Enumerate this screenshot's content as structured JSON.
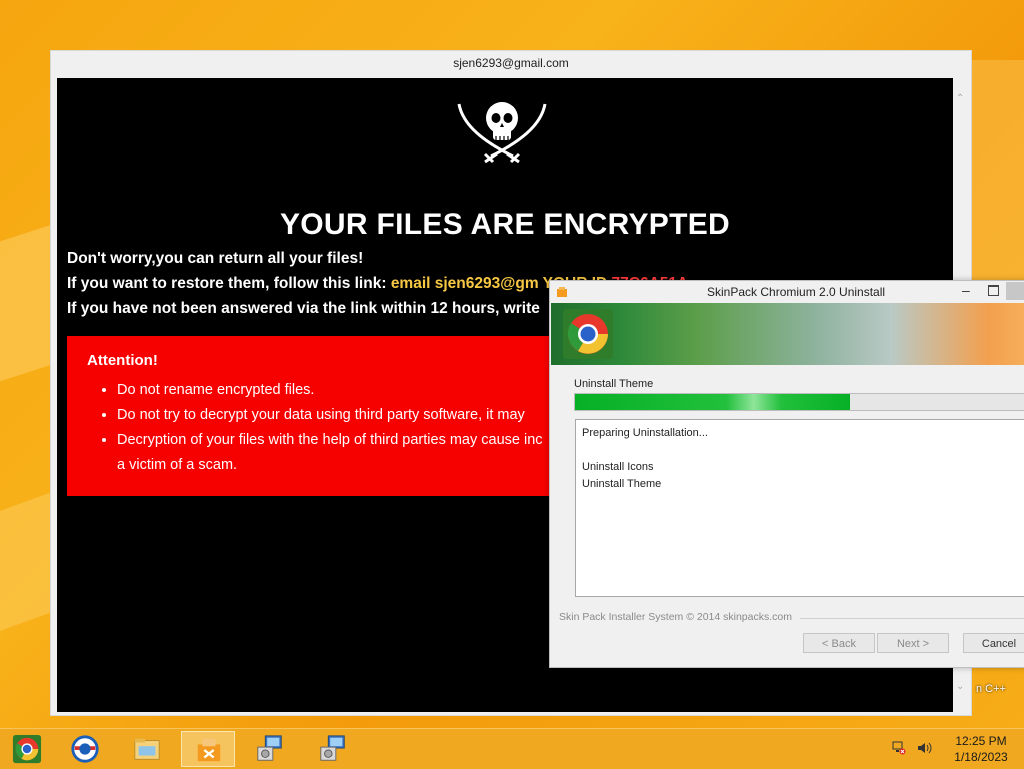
{
  "ransom_window": {
    "title": "sjen6293@gmail.com",
    "headline": "YOUR FILES ARE ENCRYPTED",
    "line1": "Don't worry,you can return all your files!",
    "line2_prefix": "If you want to restore them, follow this link: ",
    "line2_email": "email sjen6293@gm",
    "line2_tail": "  YOUR ID ",
    "line2_id": "77C6A51A",
    "line3": "If you have not been answered via the link within 12 hours, write",
    "attention": {
      "heading": "Attention!",
      "items": [
        "Do not rename encrypted files.",
        "Do not try to decrypt your data using third party software, it may",
        "Decryption of your files with the help of third parties may cause inc",
        "a victim of a scam."
      ]
    }
  },
  "installer": {
    "title": "SkinPack Chromium 2.0 Uninstall",
    "section_label": "Uninstall Theme",
    "progress": 0.6,
    "log_lines": [
      "Preparing Uninstallation...",
      "",
      "Uninstall Icons",
      "Uninstall Theme"
    ],
    "branding": "Skin Pack Installer System © 2014 skinpacks.com",
    "buttons": {
      "back": "< Back",
      "next": "Next >",
      "cancel": "Cancel"
    }
  },
  "desktop": {
    "partial_icon_label": "n C++"
  },
  "taskbar": {
    "items": [
      {
        "icon": "chrome-icon",
        "active": false
      },
      {
        "icon": "ie-icon",
        "active": false
      },
      {
        "icon": "file-explorer-icon",
        "active": false
      },
      {
        "icon": "uninstall-app-icon",
        "active": true
      },
      {
        "icon": "setup-icon",
        "active": false
      },
      {
        "icon": "setup-icon",
        "active": false
      }
    ],
    "clock_time": "12:25 PM",
    "clock_date": "1/18/2023"
  }
}
